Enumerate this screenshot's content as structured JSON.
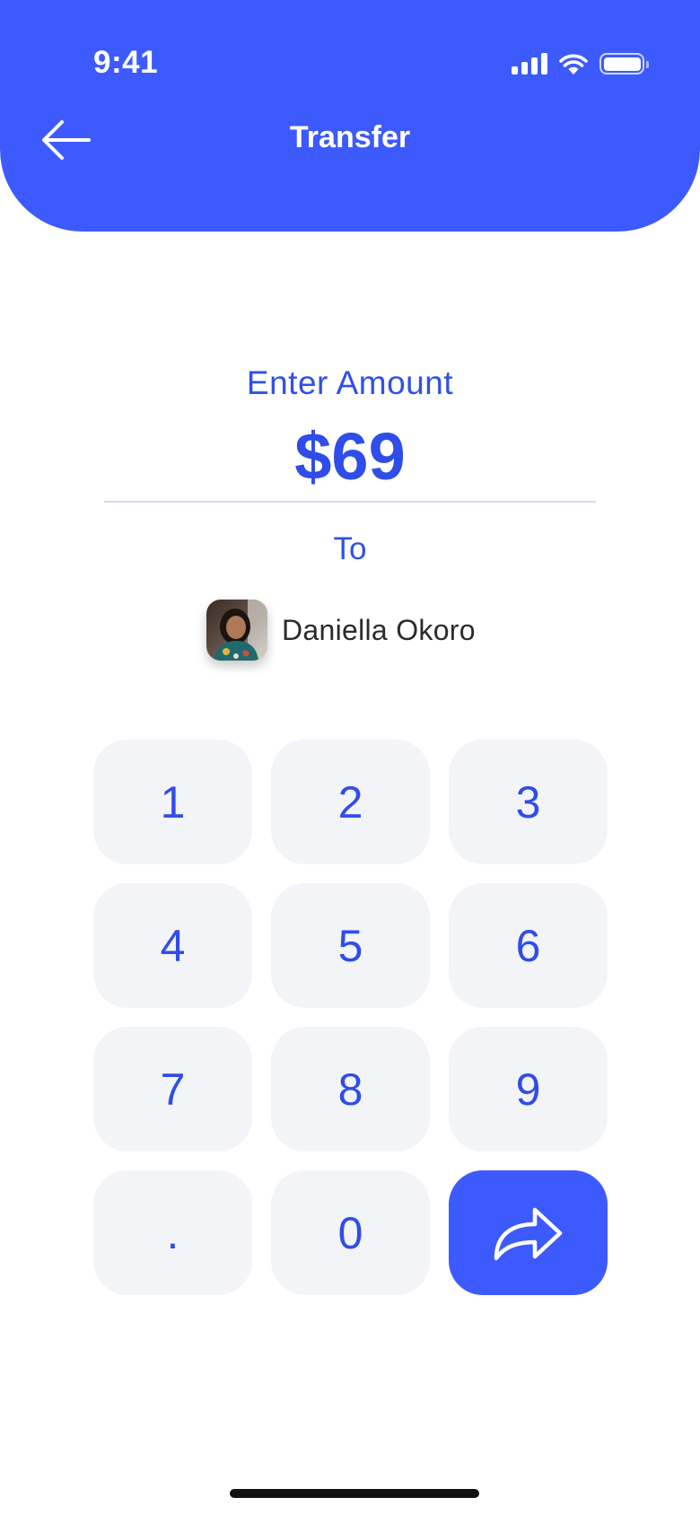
{
  "status_bar": {
    "time": "9:41",
    "icons": [
      "signal-icon",
      "wifi-icon",
      "battery-icon"
    ]
  },
  "header": {
    "title": "Transfer",
    "back_icon": "arrow-left-icon",
    "background_color": "#3d5afe"
  },
  "transfer": {
    "enter_label": "Enter Amount",
    "amount": "$69",
    "to_label": "To",
    "recipient_name": "Daniella Okoro"
  },
  "keypad": {
    "keys": [
      "1",
      "2",
      "3",
      "4",
      "5",
      "6",
      "7",
      "8",
      "9",
      ".",
      "0"
    ],
    "send_icon": "share-forward-icon",
    "key_color": "#f3f4f8",
    "text_color": "#2f4de8"
  }
}
